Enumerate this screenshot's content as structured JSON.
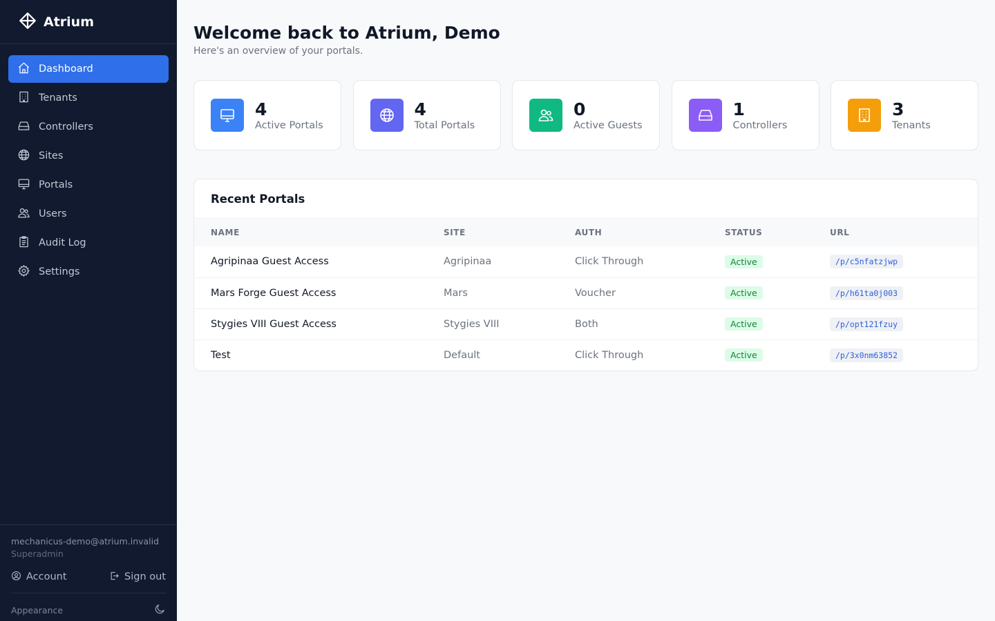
{
  "app": {
    "name": "Atrium"
  },
  "sidebar": {
    "items": [
      {
        "label": "Dashboard",
        "icon": "home-icon",
        "active": true
      },
      {
        "label": "Tenants",
        "icon": "building-icon"
      },
      {
        "label": "Controllers",
        "icon": "hard-drive-icon"
      },
      {
        "label": "Sites",
        "icon": "globe-icon"
      },
      {
        "label": "Portals",
        "icon": "monitor-icon"
      },
      {
        "label": "Users",
        "icon": "users-icon"
      },
      {
        "label": "Audit Log",
        "icon": "clipboard-icon"
      },
      {
        "label": "Settings",
        "icon": "gear-icon"
      }
    ],
    "user_email": "mechanicus-demo@atrium.invalid",
    "user_role": "Superadmin",
    "account_label": "Account",
    "signout_label": "Sign out",
    "appearance_label": "Appearance"
  },
  "header": {
    "title": "Welcome back to Atrium, Demo",
    "subtitle": "Here's an overview of your portals."
  },
  "stats": [
    {
      "value": "4",
      "label": "Active Portals",
      "color": "#3b82f6",
      "icon": "monitor-icon"
    },
    {
      "value": "4",
      "label": "Total Portals",
      "color": "#6366f1",
      "icon": "globe-icon"
    },
    {
      "value": "0",
      "label": "Active Guests",
      "color": "#10b981",
      "icon": "users-icon"
    },
    {
      "value": "1",
      "label": "Controllers",
      "color": "#8b5cf6",
      "icon": "hard-drive-icon"
    },
    {
      "value": "3",
      "label": "Tenants",
      "color": "#f59e0b",
      "icon": "building-icon"
    }
  ],
  "recent": {
    "title": "Recent Portals",
    "columns": [
      "NAME",
      "SITE",
      "AUTH",
      "STATUS",
      "URL"
    ],
    "rows": [
      {
        "name": "Agripinaa Guest Access",
        "site": "Agripinaa",
        "auth": "Click Through",
        "status": "Active",
        "url": "/p/c5nfatzjwp"
      },
      {
        "name": "Mars Forge Guest Access",
        "site": "Mars",
        "auth": "Voucher",
        "status": "Active",
        "url": "/p/h61ta0j003"
      },
      {
        "name": "Stygies VIII Guest Access",
        "site": "Stygies VIII",
        "auth": "Both",
        "status": "Active",
        "url": "/p/opt121fzuy"
      },
      {
        "name": "Test",
        "site": "Default",
        "auth": "Click Through",
        "status": "Active",
        "url": "/p/3x0nm63852"
      }
    ]
  }
}
